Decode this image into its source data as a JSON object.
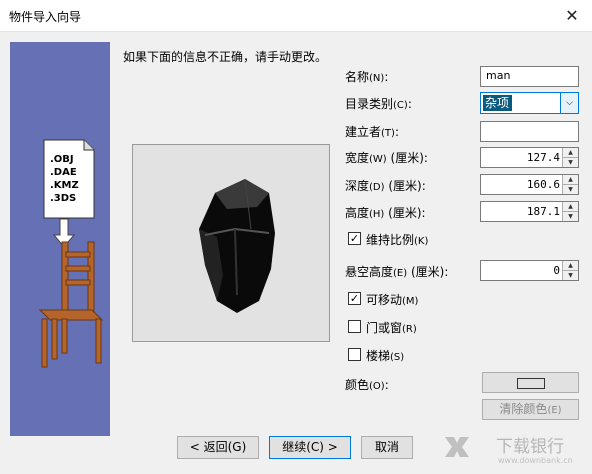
{
  "window": {
    "title": "物件导入向导",
    "close_glyph": "✕"
  },
  "intro": "如果下面的信息不正确，请手动更改。",
  "sidebar": {
    "file_formats": [
      ".OBJ",
      ".DAE",
      ".KMZ",
      ".3DS"
    ]
  },
  "fields": {
    "name": {
      "label": "名称",
      "key": "(N)",
      "value": "man"
    },
    "category": {
      "label": "目录类别",
      "key": "(C)",
      "value": "杂项"
    },
    "creator": {
      "label": "建立者",
      "key": "(T)",
      "value": ""
    },
    "width": {
      "label": "宽度",
      "key": "(W)",
      "unit": "(厘米)",
      "value": "127.4"
    },
    "depth": {
      "label": "深度",
      "key": "(D)",
      "unit": "(厘米)",
      "value": "160.6"
    },
    "height": {
      "label": "高度",
      "key": "(H)",
      "unit": "(厘米)",
      "value": "187.1"
    },
    "keep_ratio": {
      "label": "维持比例",
      "key": "(K)",
      "checked": true
    },
    "elevation": {
      "label": "悬空高度",
      "key": "(E)",
      "unit": "(厘米)",
      "value": "0"
    },
    "movable": {
      "label": "可移动",
      "key": "(M)",
      "checked": true
    },
    "door_window": {
      "label": "门或窗",
      "key": "(R)",
      "checked": false
    },
    "staircase": {
      "label": "楼梯",
      "key": "(S)",
      "checked": false
    },
    "color": {
      "label": "颜色",
      "key": "(O)"
    },
    "clear_color": {
      "label": "清除颜色",
      "key": "(E)"
    }
  },
  "buttons": {
    "back": "< 返回(G)",
    "next": "继续(C) >",
    "cancel": "取消"
  },
  "icons": {
    "check": "✓",
    "dropdown": "⌵",
    "spin_up": "▲",
    "spin_down": "▼"
  },
  "watermark": {
    "text": "下载银行",
    "url": "www.downbank.cn"
  },
  "colors": {
    "sidebar": "#6670b4",
    "selection": "#0a5a80",
    "focus": "#0078d7"
  }
}
